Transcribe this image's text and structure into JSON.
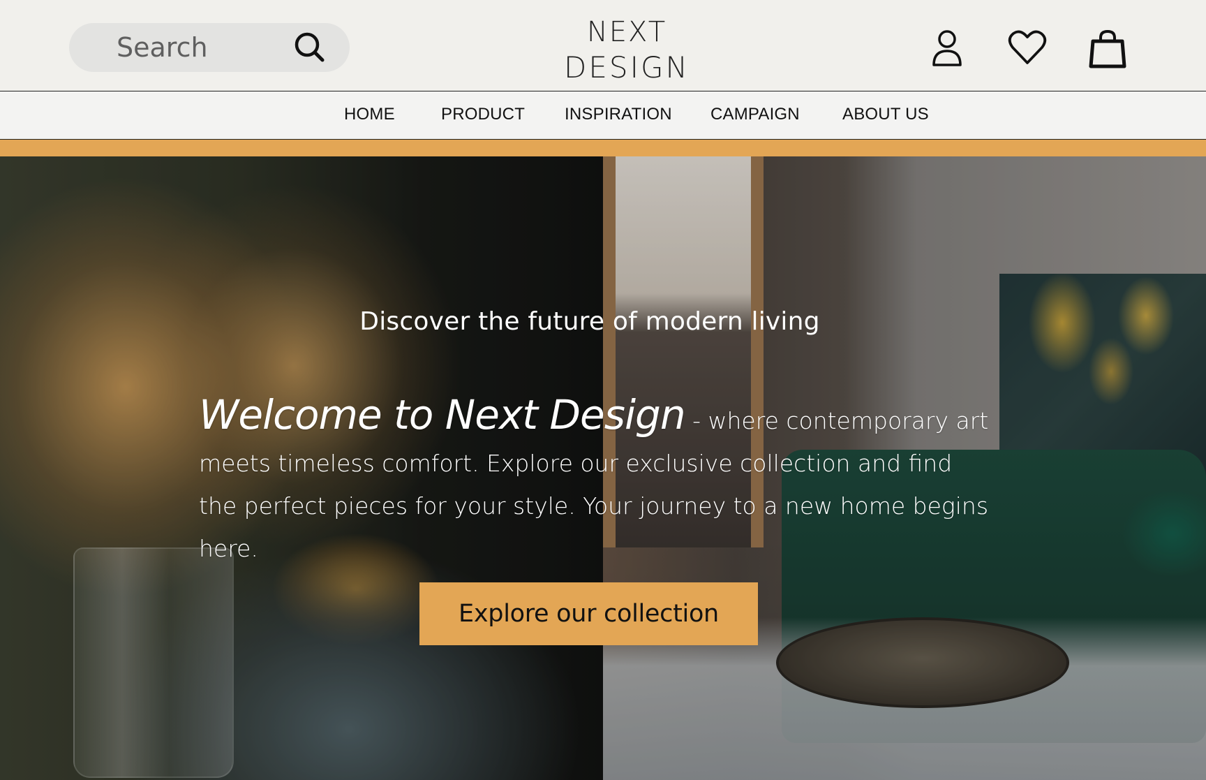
{
  "header": {
    "search_placeholder": "Search",
    "logo_line1": "NEXT",
    "logo_line2": "DESIGN",
    "icons": {
      "search": "search-icon",
      "account": "user-icon",
      "wishlist": "heart-icon",
      "cart": "shopping-bag-icon"
    }
  },
  "nav": {
    "items": [
      {
        "label": "HOME"
      },
      {
        "label": "PRODUCT"
      },
      {
        "label": "INSPIRATION"
      },
      {
        "label": "CAMPAIGN"
      },
      {
        "label": "ABOUT US"
      }
    ]
  },
  "hero": {
    "subtitle": "Discover the future of modern living",
    "welcome": "Welcome to Next Design",
    "body": " - where contemporary art meets timeless comfort. Explore our exclusive collection and find the perfect pieces for your style. Your journey to a new home begins here.",
    "cta_label": "Explore our collection"
  },
  "colors": {
    "accent": "#e3a655",
    "header_bg": "#f1f0ec",
    "nav_bg": "#f3f3f2",
    "search_bg": "#e3e3e1"
  }
}
